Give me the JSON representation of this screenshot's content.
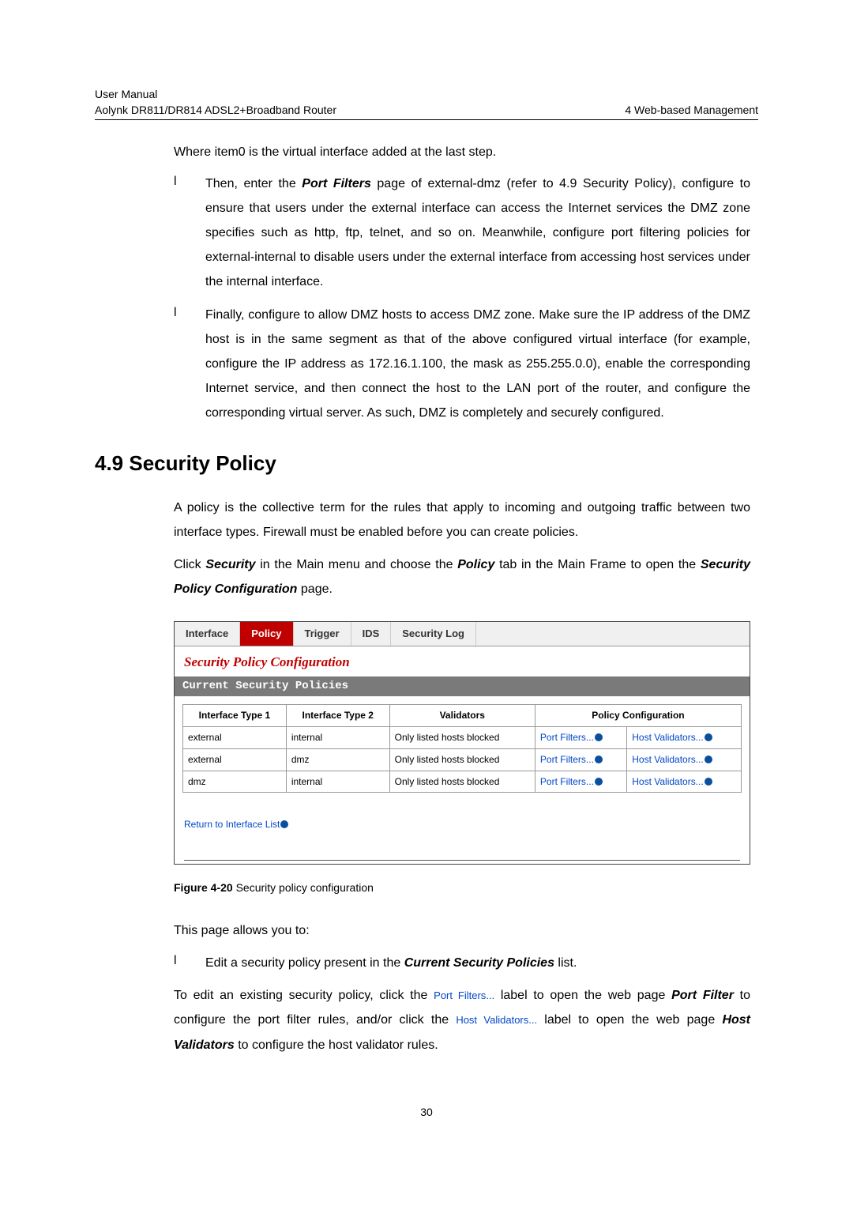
{
  "header": {
    "left_line1": "User Manual",
    "left_line2": "Aolynk DR811/DR814 ADSL2+Broadband Router",
    "right": "4  Web-based Management"
  },
  "para_intro": "Where item0 is the virtual interface added at the last step.",
  "bullets": {
    "b1_marker": "l",
    "b1_prefix": "Then, enter the ",
    "b1_bold": "Port Filters",
    "b1_rest": " page of external-dmz (refer to 4.9  Security Policy), configure to ensure that users under the external interface can access the Internet services the DMZ zone specifies such as http, ftp, telnet, and so on. Meanwhile, configure port filtering policies for external-internal to disable users under the external interface from accessing host services under the internal interface.",
    "b2_marker": "l",
    "b2_text": "Finally, configure to allow DMZ hosts to access DMZ zone. Make sure the IP address of the DMZ host is in the same segment as that of the above configured virtual interface (for example, configure the IP address as 172.16.1.100, the mask as 255.255.0.0), enable the corresponding Internet service, and then connect the host to the LAN port of the router, and configure the corresponding virtual server. As such, DMZ is completely and securely configured."
  },
  "section_heading": "4.9  Security Policy",
  "section_para1": "A policy is the collective term for the rules that apply to incoming and outgoing traffic between two interface types. Firewall must be enabled before you can create policies.",
  "section_para2_a": "Click ",
  "section_para2_b": "Security",
  "section_para2_c": " in the Main menu and choose the ",
  "section_para2_d": "Policy",
  "section_para2_e": " tab in the Main Frame to open the ",
  "section_para2_f": "Security Policy Configuration",
  "section_para2_g": " page.",
  "figure": {
    "tabs": {
      "t1": "Interface",
      "t2": "Policy",
      "t3": "Trigger",
      "t4": "IDS",
      "t5": "Security Log"
    },
    "title": "Security Policy Configuration",
    "subbar": "Current Security Policies",
    "th1": "Interface Type 1",
    "th2": "Interface Type 2",
    "th3": "Validators",
    "th4": "Policy Configuration",
    "rows": [
      {
        "c1": "external",
        "c2": "internal",
        "c3": "Only listed hosts blocked",
        "pf": "Port Filters...",
        "hv": "Host Validators..."
      },
      {
        "c1": "external",
        "c2": "dmz",
        "c3": "Only listed hosts blocked",
        "pf": "Port Filters...",
        "hv": "Host Validators..."
      },
      {
        "c1": "dmz",
        "c2": "internal",
        "c3": "Only listed hosts blocked",
        "pf": "Port Filters...",
        "hv": "Host Validators..."
      }
    ],
    "return_link": "Return to Interface List"
  },
  "figure_caption_bold": "Figure 4-20",
  "figure_caption_rest": " Security policy configuration",
  "after_fig1": "This page allows you to:",
  "after_bullet_marker": "l",
  "after_bullet_a": "Edit a security policy present in the ",
  "after_bullet_b": "Current Security Policies",
  "after_bullet_c": " list.",
  "edit_para_a": "To edit an existing security policy, click the ",
  "edit_para_pf": "Port Filters...",
  "edit_para_b": " label to open the web page ",
  "edit_para_c": "Port Filter",
  "edit_para_d": " to configure the port filter rules, and/or click the ",
  "edit_para_hv": "Host Validators...",
  "edit_para_e": " label to open the web page ",
  "edit_para_f": "Host Validators",
  "edit_para_g": " to configure the host validator rules.",
  "page_number": "30"
}
